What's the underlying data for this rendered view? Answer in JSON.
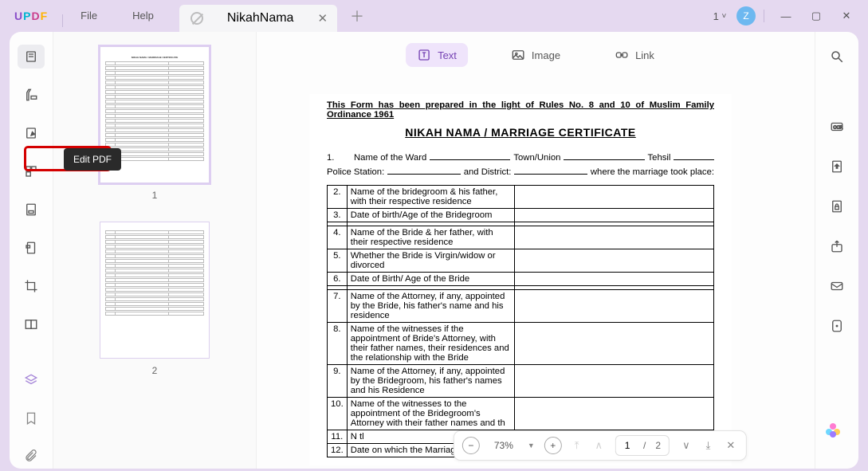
{
  "app": {
    "logo": "UPDF"
  },
  "menu": {
    "file": "File",
    "help": "Help"
  },
  "tab": {
    "title": "NikahNama"
  },
  "header": {
    "count": "1",
    "avatar": "Z"
  },
  "tooltip": {
    "edit": "Edit PDF"
  },
  "thumbs": {
    "p1": "1",
    "p2": "2"
  },
  "toolbar": {
    "text": "Text",
    "image": "Image",
    "link": "Link"
  },
  "doc": {
    "note": "This Form has been prepared in the light of Rules No. 8 and 10 of Muslim Family Ordinance 1961",
    "title": "NIKAH NAMA / MARRIAGE CERTIFICATE",
    "l1num": "1.",
    "l1a": "Name of the Ward",
    "l1b": "Town/Union",
    "l1c": "Tehsil",
    "l2a": "Police Station:",
    "l2b": " and District:",
    "l2c": "where the marriage took place:",
    "rows": [
      {
        "n": "2.",
        "t": "Name of the bridegroom & his father, with their respective residence"
      },
      {
        "n": "3.",
        "t": "Date of birth/Age of the Bridegroom"
      },
      {
        "n": "4.",
        "t": "Name of  the Bride & her father, with their respective residence"
      },
      {
        "n": "5.",
        "t": "Whether the Bride is Virgin/widow or divorced"
      },
      {
        "n": "6.",
        "t": "Date of Birth/ Age of the Bride"
      },
      {
        "n": "7.",
        "t": "Name of  the Attorney, if any, appointed by the Bride, his father's name and his residence"
      },
      {
        "n": "8.",
        "t": "Name of the witnesses if the appointment of Bride's Attorney, with their father  names, their residences and the relationship with the Bride"
      },
      {
        "n": "9.",
        "t": "Name of the Attorney, if any, appointed by the  Bridegroom, his father's names and his Residence"
      },
      {
        "n": "10.",
        "t": "Name of the witnesses to the appointment  of the Bridegroom's Attorney with their father names and th"
      },
      {
        "n": "11.",
        "t": "N\ntl"
      },
      {
        "n": "12.",
        "t": "Date on which the Marriage was"
      }
    ]
  },
  "nav": {
    "zoom": "73%",
    "page_cur": "1",
    "page_sep": "/",
    "page_tot": "2"
  }
}
